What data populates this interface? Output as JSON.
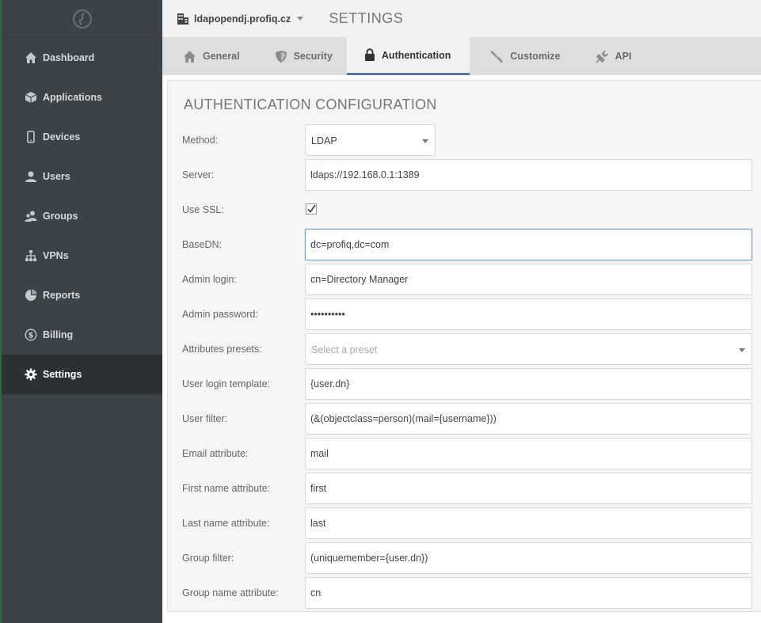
{
  "sidebar": {
    "logo_icon": "logo-icon",
    "items": [
      {
        "label": "Dashboard",
        "icon": "home-icon"
      },
      {
        "label": "Applications",
        "icon": "cube-icon"
      },
      {
        "label": "Devices",
        "icon": "phone-icon"
      },
      {
        "label": "Users",
        "icon": "user-icon"
      },
      {
        "label": "Groups",
        "icon": "users-icon"
      },
      {
        "label": "VPNs",
        "icon": "network-icon"
      },
      {
        "label": "Reports",
        "icon": "pie-chart-icon"
      },
      {
        "label": "Billing",
        "icon": "dollar-icon"
      },
      {
        "label": "Settings",
        "icon": "gear-icon",
        "active": true
      }
    ]
  },
  "header": {
    "site_name": "ldapopendj.profiq.cz",
    "title": "SETTINGS"
  },
  "tabs": [
    {
      "label": "General",
      "icon": "home-icon"
    },
    {
      "label": "Security",
      "icon": "shield-icon"
    },
    {
      "label": "Authentication",
      "icon": "lock-icon",
      "active": true
    },
    {
      "label": "Customize",
      "icon": "brush-icon"
    },
    {
      "label": "API",
      "icon": "plug-icon"
    }
  ],
  "form": {
    "title": "AUTHENTICATION CONFIGURATION",
    "method": {
      "label": "Method:",
      "value": "LDAP"
    },
    "server": {
      "label": "Server:",
      "value": "ldaps://192.168.0.1:1389"
    },
    "use_ssl": {
      "label": "Use SSL:",
      "checked": true
    },
    "base_dn": {
      "label": "BaseDN:",
      "value": "dc=profiq,dc=com"
    },
    "admin_login": {
      "label": "Admin login:",
      "value": "cn=Directory Manager"
    },
    "admin_password": {
      "label": "Admin password:",
      "value": "••••••••••"
    },
    "attributes_presets": {
      "label": "Attributes presets:",
      "placeholder": "Select a preset"
    },
    "user_login_template": {
      "label": "User login template:",
      "value": "{user.dn}"
    },
    "user_filter": {
      "label": "User filter:",
      "value": "(&(objectclass=person)(mail={username}))"
    },
    "email_attribute": {
      "label": "Email attribute:",
      "value": "mail"
    },
    "first_name_attribute": {
      "label": "First name attribute:",
      "value": "first"
    },
    "last_name_attribute": {
      "label": "Last name attribute:",
      "value": "last"
    },
    "group_filter": {
      "label": "Group filter:",
      "value": "(uniquemember={user.dn})"
    },
    "group_name_attribute": {
      "label": "Group name attribute:",
      "value": "cn"
    }
  }
}
